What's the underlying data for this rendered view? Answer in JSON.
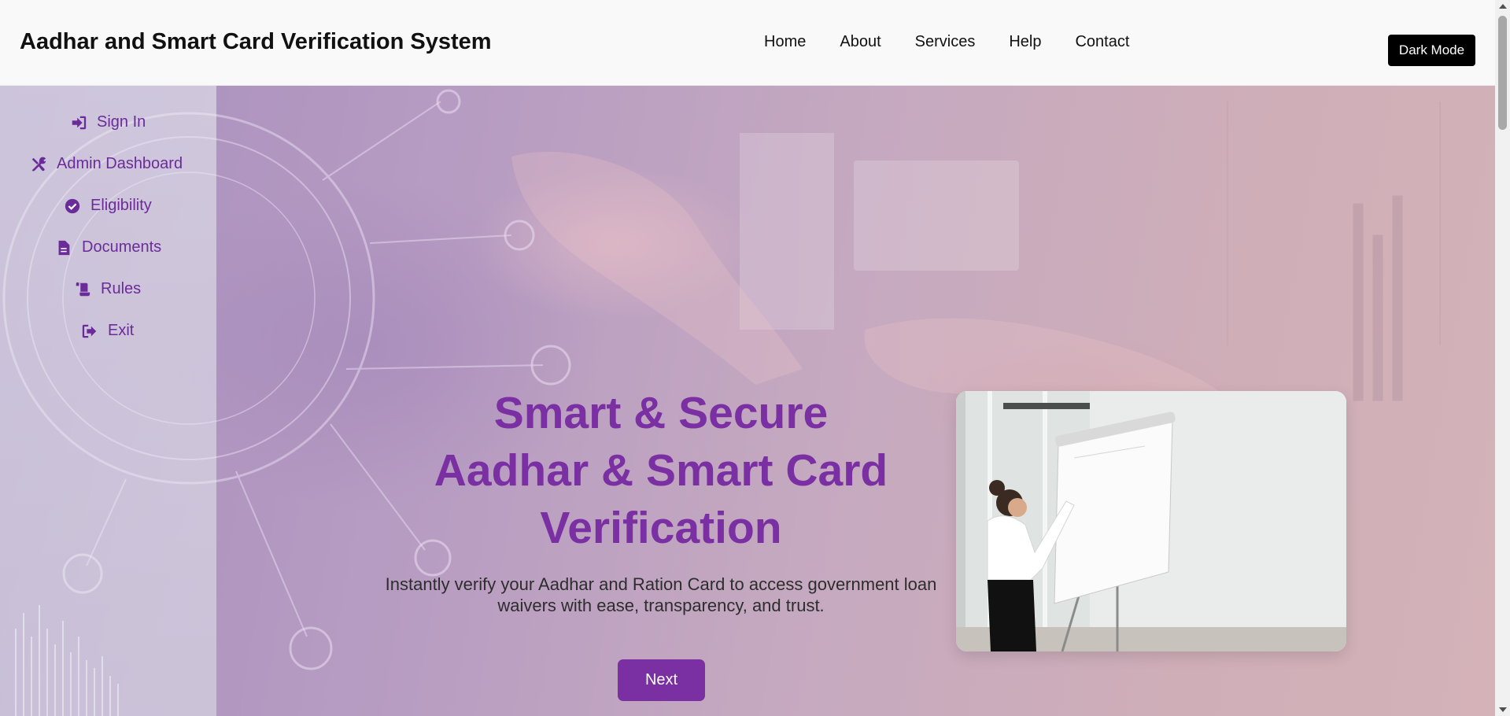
{
  "header": {
    "brand": "Aadhar and Smart Card Verification System",
    "nav": [
      "Home",
      "About",
      "Services",
      "Help",
      "Contact"
    ],
    "dark_mode_label": "Dark Mode"
  },
  "sidebar": {
    "items": [
      {
        "label": "Sign In",
        "icon": "sign-in-icon"
      },
      {
        "label": "Admin Dashboard",
        "icon": "tools-icon"
      },
      {
        "label": "Eligibility",
        "icon": "check-circle-icon"
      },
      {
        "label": "Documents",
        "icon": "document-icon"
      },
      {
        "label": "Rules",
        "icon": "scroll-icon"
      },
      {
        "label": "Exit",
        "icon": "sign-out-icon"
      }
    ]
  },
  "hero": {
    "headline": [
      "Smart & Secure",
      "Aadhar & Smart Card",
      "Verification"
    ],
    "subtext_lines": [
      "Instantly verify your Aadhar and Ration Card to access government loan",
      "waivers with ease, transparency, and trust."
    ],
    "next_label": "Next"
  },
  "colors": {
    "accent": "#7a2fa3",
    "sidebar_text": "#6b2b99",
    "header_bg": "#f9f9f9",
    "dark_button": "#000000"
  }
}
